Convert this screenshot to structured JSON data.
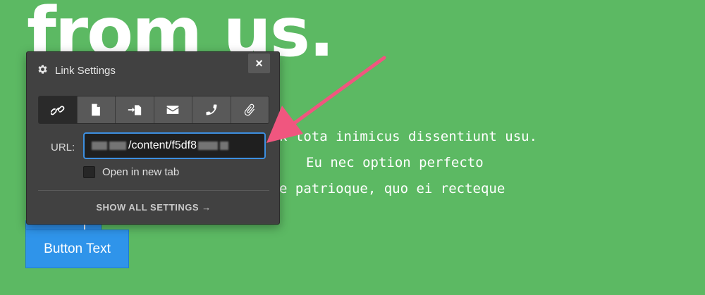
{
  "page": {
    "hero_title": "from us.",
    "body_lines": [
      "k tota inimicus dissentiunt usu.",
      "Eu nec option perfecto",
      "e patrioque, quo ei recteque"
    ],
    "button_text": "Button Text"
  },
  "popover": {
    "title": "Link Settings",
    "header_icon": "gear-icon",
    "close_label": "×",
    "tabs": [
      {
        "name": "link-icon",
        "active": true
      },
      {
        "name": "page-icon",
        "active": false
      },
      {
        "name": "anchor-jump-icon",
        "active": false
      },
      {
        "name": "email-icon",
        "active": false
      },
      {
        "name": "phone-icon",
        "active": false
      },
      {
        "name": "attachment-icon",
        "active": false
      }
    ],
    "url_label": "URL:",
    "url_value": "/content/f5df8",
    "open_new_tab_label": "Open in new tab",
    "open_new_tab_checked": false,
    "show_all_label": "SHOW ALL SETTINGS →"
  },
  "colors": {
    "background": "#5cb963",
    "popover": "#414141",
    "accent": "#3d8fe0",
    "button": "#2f94ea",
    "arrow": "#f0567f"
  }
}
